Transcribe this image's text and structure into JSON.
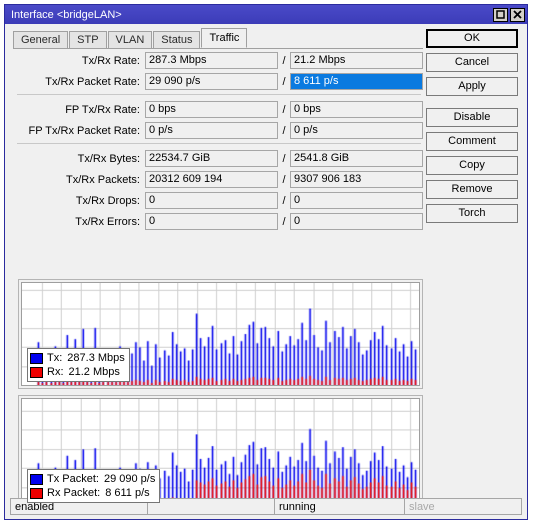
{
  "window": {
    "title": "Interface <bridgeLAN>",
    "maximize_icon": "maximize-icon",
    "close_icon": "close-icon"
  },
  "tabs": [
    {
      "label": "General",
      "active": false
    },
    {
      "label": "STP",
      "active": false
    },
    {
      "label": "VLAN",
      "active": false
    },
    {
      "label": "Status",
      "active": false
    },
    {
      "label": "Traffic",
      "active": true
    }
  ],
  "fields": [
    {
      "label": "Tx/Rx Rate:",
      "tx": "287.3 Mbps",
      "rx": "21.2 Mbps",
      "selected": false
    },
    {
      "label": "Tx/Rx Packet Rate:",
      "tx": "29 090 p/s",
      "rx": "8 611 p/s",
      "selected": true
    },
    {
      "label": "FP Tx/Rx Rate:",
      "tx": "0 bps",
      "rx": "0 bps",
      "selected": false
    },
    {
      "label": "FP Tx/Rx Packet Rate:",
      "tx": "0 p/s",
      "rx": "0 p/s",
      "selected": false
    },
    {
      "label": "Tx/Rx Bytes:",
      "tx": "22534.7 GiB",
      "rx": "2541.8 GiB",
      "selected": false
    },
    {
      "label": "Tx/Rx Packets:",
      "tx": "20312 609 194",
      "rx": "9307 906 183",
      "selected": false
    },
    {
      "label": "Tx/Rx Drops:",
      "tx": "0",
      "rx": "0",
      "selected": false
    },
    {
      "label": "Tx/Rx Errors:",
      "tx": "0",
      "rx": "0",
      "selected": false
    }
  ],
  "separator": "/",
  "buttons": [
    {
      "label": "OK",
      "primary": true
    },
    {
      "label": "Cancel",
      "primary": false
    },
    {
      "label": "Apply",
      "primary": false
    },
    {
      "label": "Disable",
      "primary": false
    },
    {
      "label": "Comment",
      "primary": false
    },
    {
      "label": "Copy",
      "primary": false
    },
    {
      "label": "Remove",
      "primary": false
    },
    {
      "label": "Torch",
      "primary": false
    }
  ],
  "colors": {
    "tx": "#0000ee",
    "rx": "#ee0000",
    "title_bar": "#4040c0",
    "selection": "#0a7ae0",
    "grid": "#d0d0d0"
  },
  "legends": {
    "rate": [
      {
        "name": "Tx:",
        "value": "287.3 Mbps",
        "color": "#0000ee"
      },
      {
        "name": "Rx:",
        "value": "21.2 Mbps",
        "color": "#ee0000"
      }
    ],
    "packet": [
      {
        "name": "Tx Packet:",
        "value": "29 090 p/s",
        "color": "#0000ee"
      },
      {
        "name": "Rx Packet:",
        "value": "8 611 p/s",
        "color": "#ee0000"
      }
    ]
  },
  "statusbar": [
    {
      "text": "enabled",
      "dim": false
    },
    {
      "text": "",
      "dim": false
    },
    {
      "text": "running",
      "dim": false
    },
    {
      "text": "slave",
      "dim": true
    }
  ],
  "chart_data": [
    {
      "type": "bar",
      "title": "Traffic rate history",
      "xlabel": "",
      "ylabel": "",
      "grid": true,
      "ylim": [
        0,
        100
      ],
      "series": [
        {
          "name": "Tx",
          "color": "#0000ee",
          "unit": "Mbps",
          "values": [
            0,
            0,
            0,
            0,
            42,
            20,
            24,
            13,
            38,
            31,
            15,
            49,
            27,
            45,
            29,
            55,
            24,
            20,
            56,
            18,
            22,
            21,
            27,
            26,
            38,
            33,
            20,
            31,
            42,
            37,
            24,
            43,
            19,
            40,
            27,
            34,
            29,
            52,
            40,
            33,
            36,
            24,
            35,
            70,
            46,
            38,
            47,
            58,
            35,
            41,
            44,
            31,
            48,
            30,
            43,
            50,
            59,
            62,
            41,
            56,
            57,
            46,
            38,
            53,
            33,
            40,
            48,
            39,
            45,
            61,
            44,
            75,
            49,
            37,
            34,
            63,
            42,
            53,
            47,
            57,
            36,
            48,
            55,
            42,
            30,
            34,
            44,
            52,
            45,
            58,
            39,
            36,
            46,
            33,
            40,
            28,
            43,
            35
          ]
        },
        {
          "name": "Rx",
          "color": "#ee0000",
          "unit": "Mbps",
          "values": [
            0,
            0,
            0,
            0,
            3,
            2,
            3,
            2,
            3,
            3,
            2,
            4,
            3,
            4,
            3,
            4,
            3,
            2,
            5,
            2,
            3,
            3,
            3,
            3,
            4,
            4,
            3,
            4,
            5,
            4,
            3,
            5,
            2,
            5,
            3,
            4,
            3,
            6,
            5,
            4,
            5,
            3,
            4,
            8,
            6,
            5,
            6,
            7,
            4,
            5,
            6,
            4,
            6,
            4,
            5,
            6,
            7,
            8,
            5,
            7,
            7,
            6,
            5,
            7,
            4,
            5,
            6,
            5,
            6,
            8,
            6,
            9,
            6,
            5,
            4,
            8,
            5,
            7,
            6,
            7,
            5,
            6,
            7,
            5,
            4,
            5,
            6,
            7,
            6,
            8,
            5,
            5,
            6,
            4,
            5,
            4,
            6,
            5
          ]
        }
      ]
    },
    {
      "type": "bar",
      "title": "Packet rate history",
      "xlabel": "",
      "ylabel": "",
      "grid": true,
      "ylim": [
        0,
        100
      ],
      "series": [
        {
          "name": "Tx Packet",
          "color": "#0000ee",
          "unit": "p/s",
          "values": [
            0,
            0,
            0,
            0,
            40,
            19,
            22,
            12,
            36,
            29,
            14,
            47,
            26,
            43,
            28,
            53,
            23,
            19,
            54,
            17,
            21,
            20,
            26,
            25,
            36,
            32,
            19,
            30,
            40,
            35,
            23,
            41,
            18,
            38,
            26,
            33,
            28,
            50,
            38,
            32,
            35,
            23,
            34,
            67,
            44,
            36,
            45,
            56,
            34,
            39,
            42,
            30,
            46,
            29,
            41,
            48,
            57,
            60,
            39,
            54,
            55,
            44,
            36,
            51,
            32,
            38,
            46,
            37,
            43,
            59,
            42,
            72,
            47,
            36,
            33,
            61,
            40,
            51,
            45,
            55,
            35,
            46,
            53,
            40,
            29,
            33,
            42,
            50,
            43,
            56,
            37,
            35,
            44,
            32,
            38,
            27,
            41,
            34
          ]
        },
        {
          "name": "Rx Packet",
          "color": "#ee0000",
          "unit": "p/s",
          "values": [
            0,
            0,
            0,
            0,
            5,
            4,
            5,
            3,
            5,
            5,
            4,
            6,
            5,
            6,
            5,
            7,
            5,
            4,
            7,
            4,
            5,
            4,
            5,
            5,
            6,
            6,
            4,
            6,
            7,
            6,
            5,
            7,
            4,
            7,
            5,
            6,
            5,
            8,
            7,
            6,
            7,
            5,
            6,
            24,
            22,
            20,
            23,
            26,
            19,
            21,
            23,
            18,
            24,
            17,
            22,
            25,
            28,
            30,
            20,
            27,
            28,
            23,
            19,
            26,
            17,
            20,
            24,
            19,
            23,
            30,
            22,
            34,
            24,
            19,
            17,
            30,
            21,
            26,
            23,
            28,
            18,
            24,
            27,
            21,
            16,
            18,
            22,
            26,
            22,
            28,
            19,
            18,
            23,
            17,
            20,
            15,
            22,
            18
          ]
        }
      ]
    }
  ]
}
